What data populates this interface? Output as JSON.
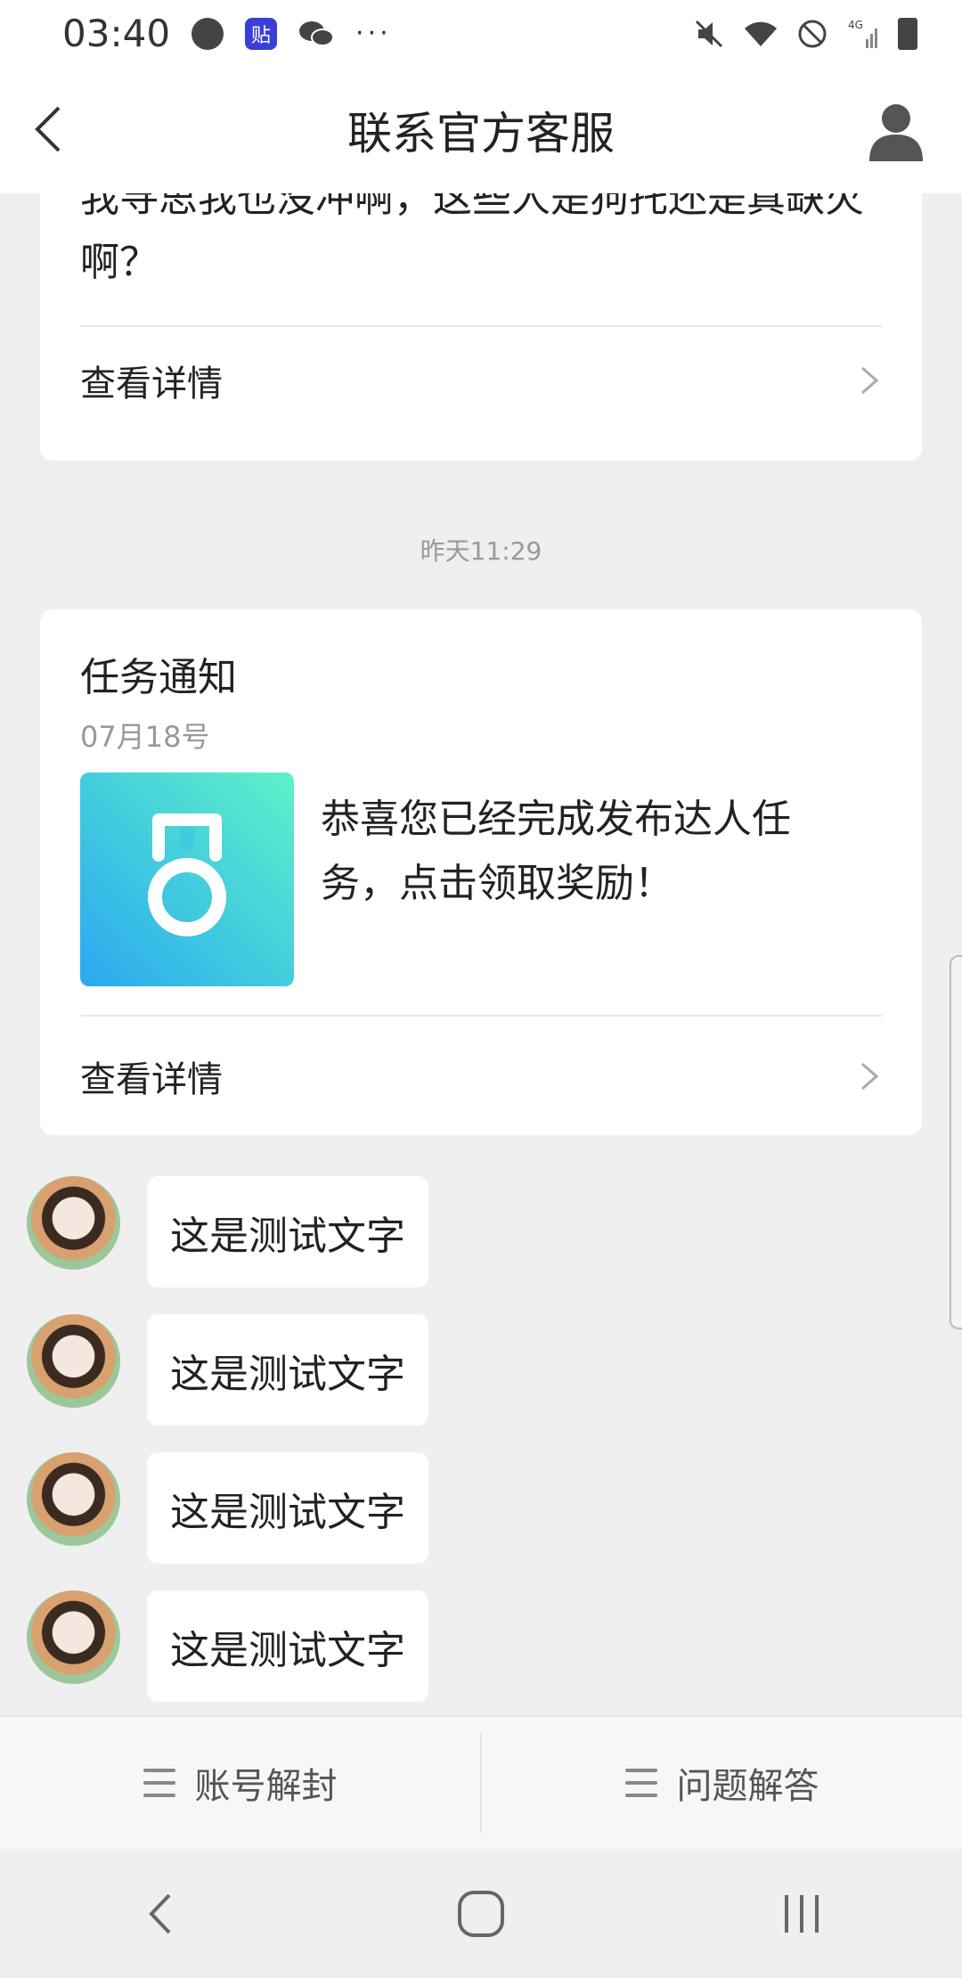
{
  "status_bar": {
    "time": "03:40",
    "app_icon_label": "贴",
    "more": "···",
    "icons": [
      "refresh-icon",
      "app-icon",
      "wechat-icon",
      "mute-icon",
      "wifi-icon",
      "do-not-disturb-icon",
      "signal-icon",
      "battery-icon"
    ]
  },
  "header": {
    "title": "联系官方客服"
  },
  "messages": {
    "top_card": {
      "text": "我寻思我也没冲啊，这些人是狗托还是真缺火啊？",
      "detail_label": "查看详情"
    },
    "timestamp": "昨天11:29",
    "task_card": {
      "title": "任务通知",
      "date": "07月18号",
      "text": "恭喜您已经完成发布达人任务，点击领取奖励！",
      "detail_label": "查看详情",
      "icon": "medal-icon"
    },
    "chat": [
      {
        "text": "这是测试文字"
      },
      {
        "text": "这是测试文字"
      },
      {
        "text": "这是测试文字"
      },
      {
        "text": "这是测试文字"
      }
    ]
  },
  "bottom_menu": {
    "items": [
      {
        "label": "账号解封",
        "icon": "menu-icon"
      },
      {
        "label": "问题解答",
        "icon": "menu-icon"
      }
    ]
  },
  "nav_bar": {
    "icons": [
      "back-icon",
      "home-icon",
      "recents-icon"
    ]
  },
  "colors": {
    "background": "#efefef",
    "card": "#ffffff",
    "muted_text": "#999999",
    "icon_gradient_start": "#2aa8f2",
    "icon_gradient_end": "#5ef2c8"
  }
}
